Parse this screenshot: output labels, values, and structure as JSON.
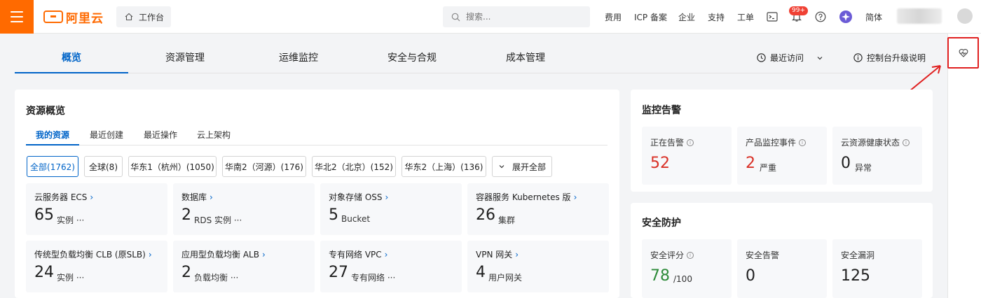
{
  "header": {
    "logo_text": "阿里云",
    "workbench_label": "工作台",
    "search_placeholder": "搜索...",
    "nav": [
      "费用",
      "ICP 备案",
      "企业",
      "支持",
      "工单"
    ],
    "notification_badge": "99+",
    "language": "简体"
  },
  "tabs": [
    "概览",
    "资源管理",
    "运维监控",
    "安全与合规",
    "成本管理"
  ],
  "toolbar": {
    "recent_label": "最近访问",
    "upgrade_label": "控制台升级说明"
  },
  "resources": {
    "title": "资源概览",
    "subtabs": [
      "我的资源",
      "最近创建",
      "最近操作",
      "云上架构"
    ],
    "filters": [
      "全部(1762)",
      "全球(8)",
      "华东1（杭州）(1050)",
      "华南2（河源）(176)",
      "华北2（北京）(152)",
      "华东2（上海）(136)"
    ],
    "expand_label": "展开全部",
    "cards": [
      {
        "name": "云服务器 ECS",
        "value": "65",
        "unit": "实例 ···"
      },
      {
        "name": "数据库",
        "value": "2",
        "unit": "RDS 实例 ···"
      },
      {
        "name": "对象存储 OSS",
        "value": "5",
        "unit": "Bucket"
      },
      {
        "name": "容器服务 Kubernetes 版",
        "value": "26",
        "unit": "集群"
      },
      {
        "name": "传统型负载均衡 CLB (原SLB)",
        "value": "24",
        "unit": "实例 ···"
      },
      {
        "name": "应用型负载均衡 ALB",
        "value": "2",
        "unit": "负载均衡 ···"
      },
      {
        "name": "专有网络 VPC",
        "value": "27",
        "unit": "专有网络 ···"
      },
      {
        "name": "VPN 网关",
        "value": "4",
        "unit": "用户网关"
      }
    ]
  },
  "monitoring": {
    "title": "监控告警",
    "stats": [
      {
        "label": "正在告警",
        "value": "52",
        "sub": ""
      },
      {
        "label": "产品监控事件",
        "value": "2",
        "sub": "严重"
      },
      {
        "label": "云资源健康状态",
        "value": "0",
        "sub": "异常"
      }
    ]
  },
  "security": {
    "title": "安全防护",
    "stats": [
      {
        "label": "安全评分",
        "value": "78",
        "sub": "/100"
      },
      {
        "label": "安全告警",
        "value": "0",
        "sub": ""
      },
      {
        "label": "安全漏洞",
        "value": "125",
        "sub": ""
      }
    ]
  },
  "colors": {
    "brand": "#ff6a00",
    "accent": "#0064c8",
    "alert": "#d93026",
    "good": "#2e8b3a",
    "annotation": "#e02020"
  }
}
